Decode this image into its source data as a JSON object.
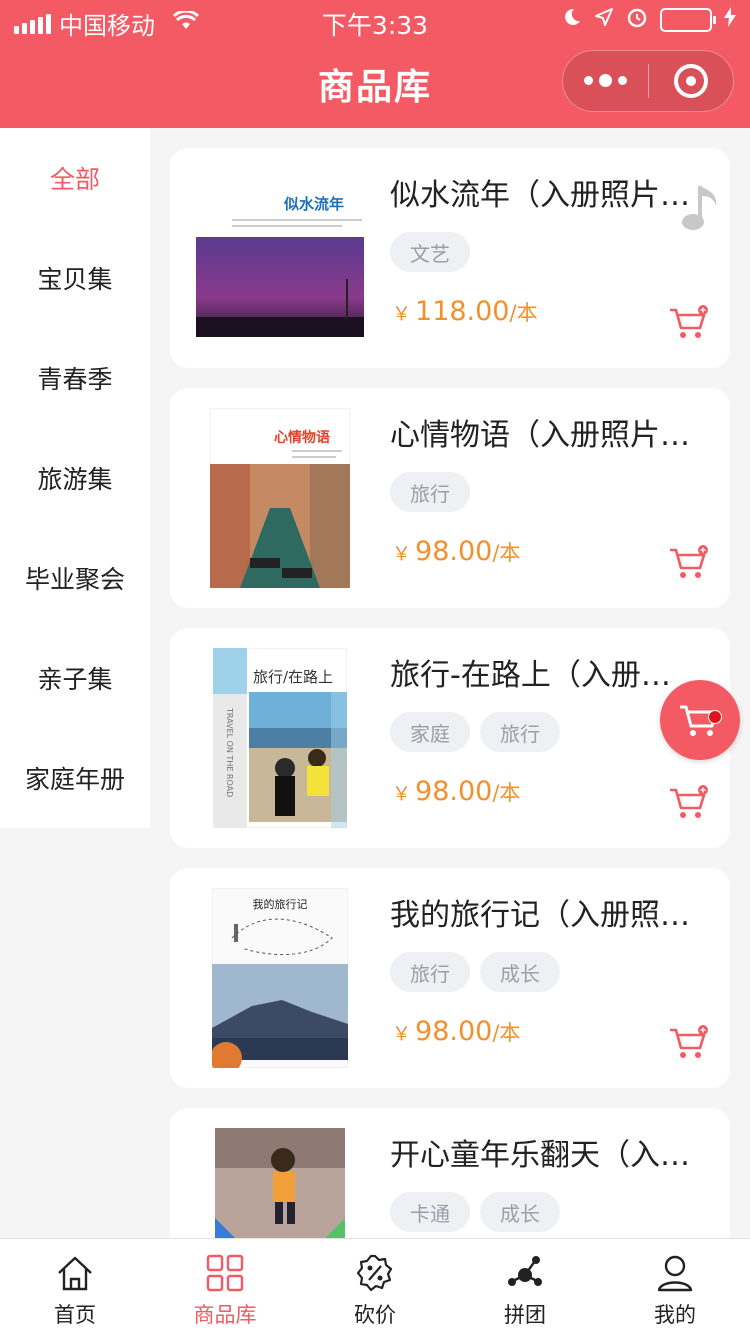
{
  "status_bar": {
    "carrier": "中国移动",
    "time": "下午3:33",
    "battery_level": 1.0
  },
  "nav": {
    "title": "商品库"
  },
  "colors": {
    "brand": "#f35a63",
    "price": "#f2912b",
    "tag_bg": "#eef0f3",
    "tag_text": "#9aa0a8"
  },
  "sidebar": {
    "items": [
      {
        "label": "全部",
        "active": true
      },
      {
        "label": "宝贝集"
      },
      {
        "label": "青春季"
      },
      {
        "label": "旅游集"
      },
      {
        "label": "毕业聚会"
      },
      {
        "label": "亲子集"
      },
      {
        "label": "家庭年册"
      }
    ]
  },
  "products": [
    {
      "title": "似水流年（入册照片…",
      "tags": [
        "文艺"
      ],
      "currency": "￥",
      "price": "118.00",
      "unit": "/本",
      "cover_text": "似水流年"
    },
    {
      "title": "心情物语（入册照片…",
      "tags": [
        "旅行"
      ],
      "currency": "￥",
      "price": "98.00",
      "unit": "/本",
      "cover_text": "心情物语"
    },
    {
      "title": "旅行-在路上（入册…",
      "tags": [
        "家庭",
        "旅行"
      ],
      "currency": "￥",
      "price": "98.00",
      "unit": "/本",
      "cover_text": "旅行/在路上",
      "cover_side_text": "TRAVEL ON THE ROAD"
    },
    {
      "title": "我的旅行记（入册照…",
      "tags": [
        "旅行",
        "成长"
      ],
      "currency": "￥",
      "price": "98.00",
      "unit": "/本",
      "cover_text": "我的旅行记"
    },
    {
      "title": "开心童年乐翻天（入…",
      "tags": [
        "卡通",
        "成长"
      ],
      "currency": "￥",
      "price": "",
      "unit": ""
    }
  ],
  "icons": {
    "music": "music-note-icon",
    "floating_cart": "cart-icon"
  },
  "tabbar": {
    "items": [
      {
        "label": "首页",
        "icon": "home-icon"
      },
      {
        "label": "商品库",
        "icon": "grid-icon",
        "active": true
      },
      {
        "label": "砍价",
        "icon": "discount-icon"
      },
      {
        "label": "拼团",
        "icon": "group-icon"
      },
      {
        "label": "我的",
        "icon": "profile-icon"
      }
    ]
  }
}
